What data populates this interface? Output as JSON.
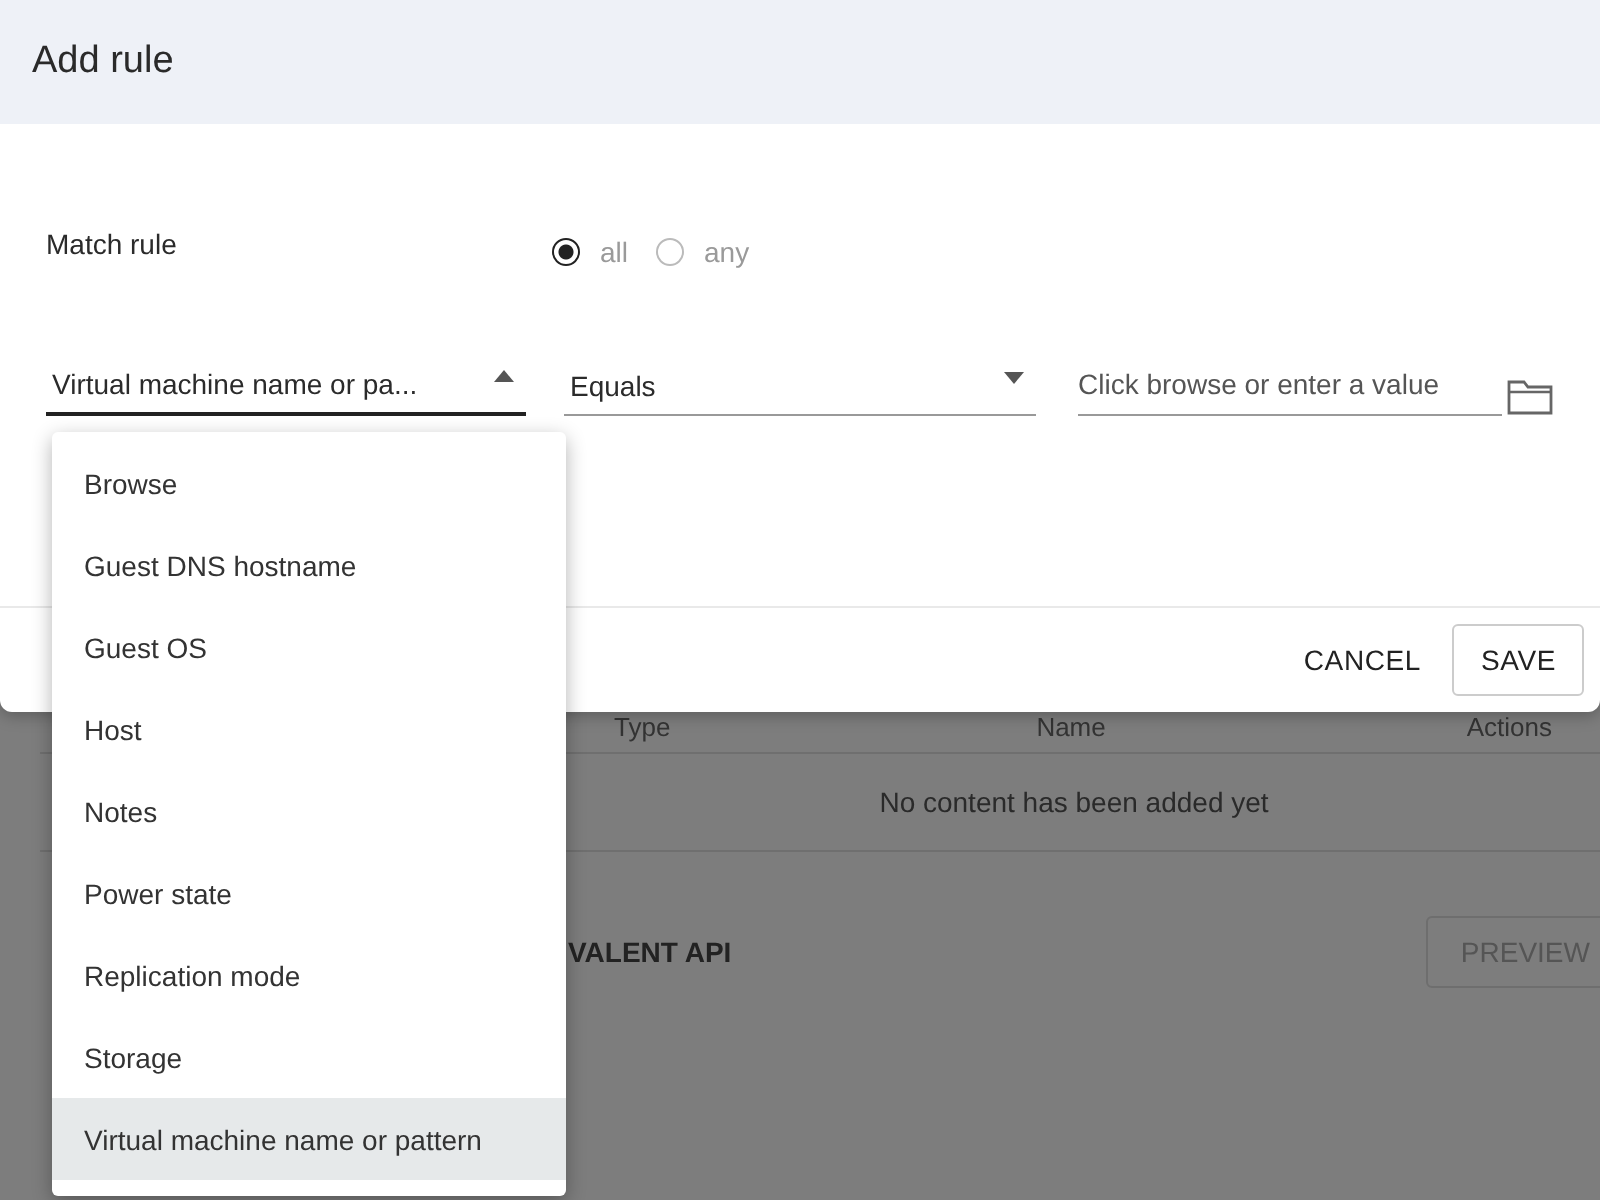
{
  "dialog": {
    "title": "Add rule",
    "match_rule": {
      "label": "Match rule",
      "options": [
        {
          "label": "all",
          "selected": true
        },
        {
          "label": "any",
          "selected": false
        }
      ]
    },
    "condition": {
      "property_field": {
        "value": "Virtual machine name or pa...",
        "expanded": true
      },
      "operator_field": {
        "value": "Equals",
        "expanded": false
      },
      "value_field": {
        "placeholder": "Click browse or enter a value"
      }
    },
    "buttons": [
      {
        "label": "CANCEL",
        "kind": "text"
      },
      {
        "label": "SAVE",
        "kind": "outlined"
      }
    ]
  },
  "property_menu": {
    "items": [
      {
        "label": "Browse",
        "selected": false
      },
      {
        "label": "Guest DNS hostname",
        "selected": false
      },
      {
        "label": "Guest OS",
        "selected": false
      },
      {
        "label": "Host",
        "selected": false
      },
      {
        "label": "Notes",
        "selected": false
      },
      {
        "label": "Power state",
        "selected": false
      },
      {
        "label": "Replication mode",
        "selected": false
      },
      {
        "label": "Storage",
        "selected": false
      },
      {
        "label": "Virtual machine name or pattern",
        "selected": true
      }
    ]
  },
  "background": {
    "table": {
      "columns": [
        "Type",
        "Name",
        "Actions"
      ],
      "empty_message": "No content has been added yet"
    },
    "section_title": "VALENT API",
    "preview_button": "PREVIEW"
  }
}
